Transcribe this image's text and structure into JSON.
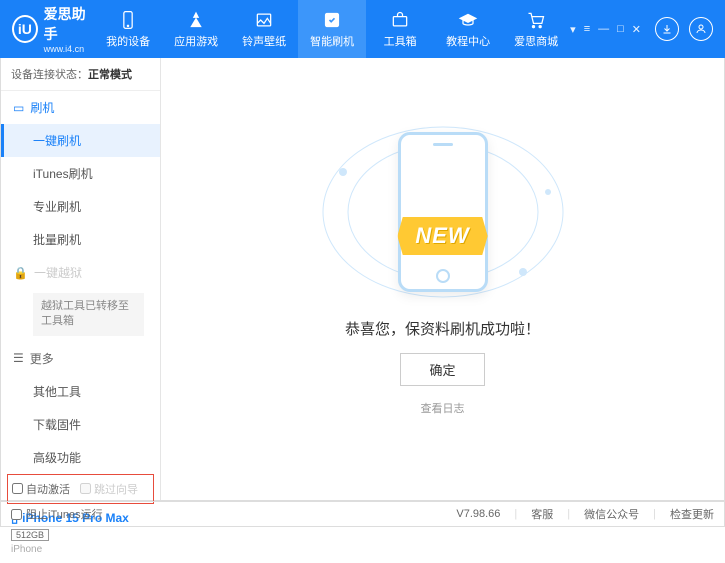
{
  "header": {
    "logo_char": "iU",
    "title": "爱思助手",
    "subtitle": "www.i4.cn",
    "nav": [
      {
        "label": "我的设备"
      },
      {
        "label": "应用游戏"
      },
      {
        "label": "铃声壁纸"
      },
      {
        "label": "智能刷机"
      },
      {
        "label": "工具箱"
      },
      {
        "label": "教程中心"
      },
      {
        "label": "爱思商城"
      }
    ]
  },
  "sidebar": {
    "status_label": "设备连接状态：",
    "status_value": "正常模式",
    "sec_flash": "刷机",
    "items_flash": [
      "一键刷机",
      "iTunes刷机",
      "专业刷机",
      "批量刷机"
    ],
    "sec_jailbreak": "一键越狱",
    "jailbreak_note": "越狱工具已转移至工具箱",
    "sec_more": "更多",
    "items_more": [
      "其他工具",
      "下载固件",
      "高级功能"
    ],
    "cb_auto": "自动激活",
    "cb_skip": "跳过向导",
    "device_name": "iPhone 15 Pro Max",
    "storage": "512GB",
    "device_type": "iPhone"
  },
  "main": {
    "ribbon": "NEW",
    "success": "恭喜您，保资料刷机成功啦！",
    "ok": "确定",
    "log": "查看日志"
  },
  "footer": {
    "block_itunes": "阻止iTunes运行",
    "version": "V7.98.66",
    "links": [
      "客服",
      "微信公众号",
      "检查更新"
    ]
  }
}
